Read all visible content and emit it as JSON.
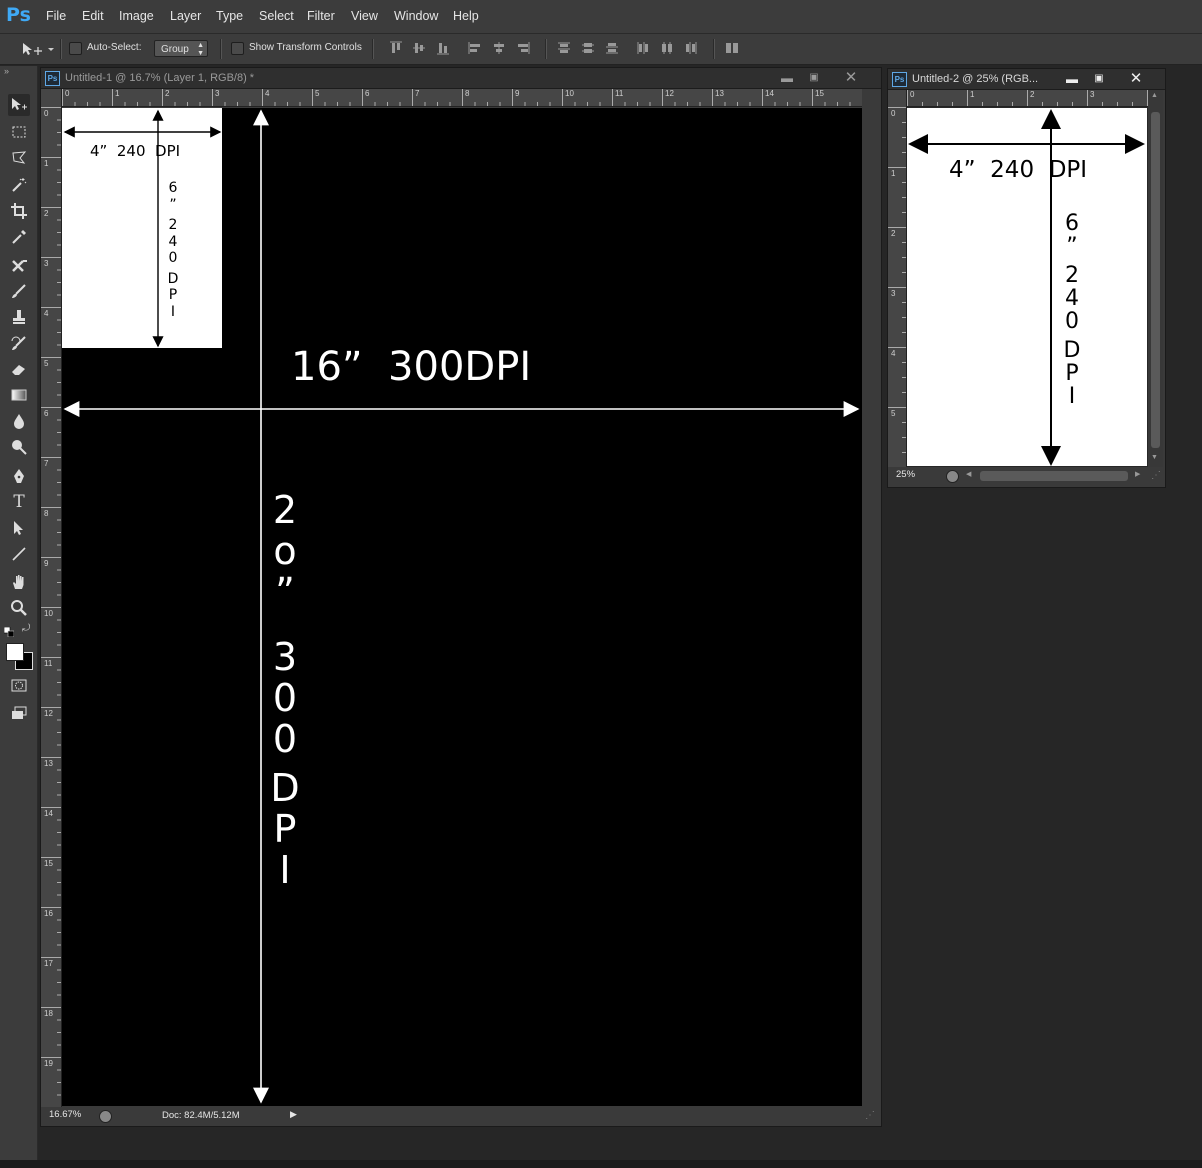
{
  "app": {
    "logo": "Ps"
  },
  "menu": [
    "File",
    "Edit",
    "Image",
    "Layer",
    "Type",
    "Select",
    "Filter",
    "View",
    "Window",
    "Help"
  ],
  "options": {
    "auto_select_label": "Auto-Select:",
    "auto_select_checked": false,
    "group_value": "Group",
    "show_transform_label": "Show Transform Controls",
    "show_transform_checked": false
  },
  "tools": [
    "move-tool-icon",
    "rectangular-marquee-icon",
    "polygonal-lasso-icon",
    "magic-wand-icon",
    "crop-icon",
    "eyedropper-icon",
    "healing-brush-icon",
    "brush-icon",
    "clone-stamp-icon",
    "history-brush-icon",
    "eraser-icon",
    "gradient-icon",
    "blur-icon",
    "dodge-icon",
    "pen-icon",
    "type-icon",
    "path-selection-icon",
    "line-icon",
    "hand-icon",
    "zoom-icon"
  ],
  "doc1": {
    "ps": "Ps",
    "title": "Untitled-1 @ 16.7% (Layer 1, RGB/8) *",
    "ruler_h": [
      "0",
      "1",
      "2",
      "3",
      "4",
      "5",
      "6",
      "7",
      "8",
      "9",
      "10",
      "11",
      "12",
      "13",
      "14",
      "15"
    ],
    "ruler_v": [
      "0",
      "1",
      "2",
      "3",
      "4",
      "5",
      "6",
      "7",
      "8",
      "9",
      "10",
      "11",
      "12",
      "13",
      "14",
      "15",
      "16",
      "17",
      "18",
      "19"
    ],
    "inset": {
      "width_label": "4”  240  DPI",
      "height_chars": [
        "6",
        "”",
        "2",
        "4",
        "0",
        "D",
        "P",
        "I"
      ]
    },
    "width_label": "16”  300DPI",
    "height_chars": [
      "2",
      "o",
      "”",
      "3",
      "0",
      "0",
      "D",
      "P",
      "I"
    ],
    "zoom": "16.67%",
    "doc_size": "Doc: 82.4M/5.12M"
  },
  "doc2": {
    "ps": "Ps",
    "title": "Untitled-2 @ 25% (RGB...",
    "ruler_h": [
      "0",
      "1",
      "2",
      "3"
    ],
    "ruler_v": [
      "0",
      "1",
      "2",
      "3",
      "4",
      "5"
    ],
    "width_label": "4”  240  DPI",
    "height_chars": [
      "6",
      "”",
      "2",
      "4",
      "0",
      "D",
      "P",
      "I"
    ],
    "zoom": "25%"
  },
  "colors": {
    "foreground": "#ffffff",
    "background": "#000000",
    "ui_dark": "#3c3c3c",
    "ps_blue": "#3fa9f5"
  }
}
